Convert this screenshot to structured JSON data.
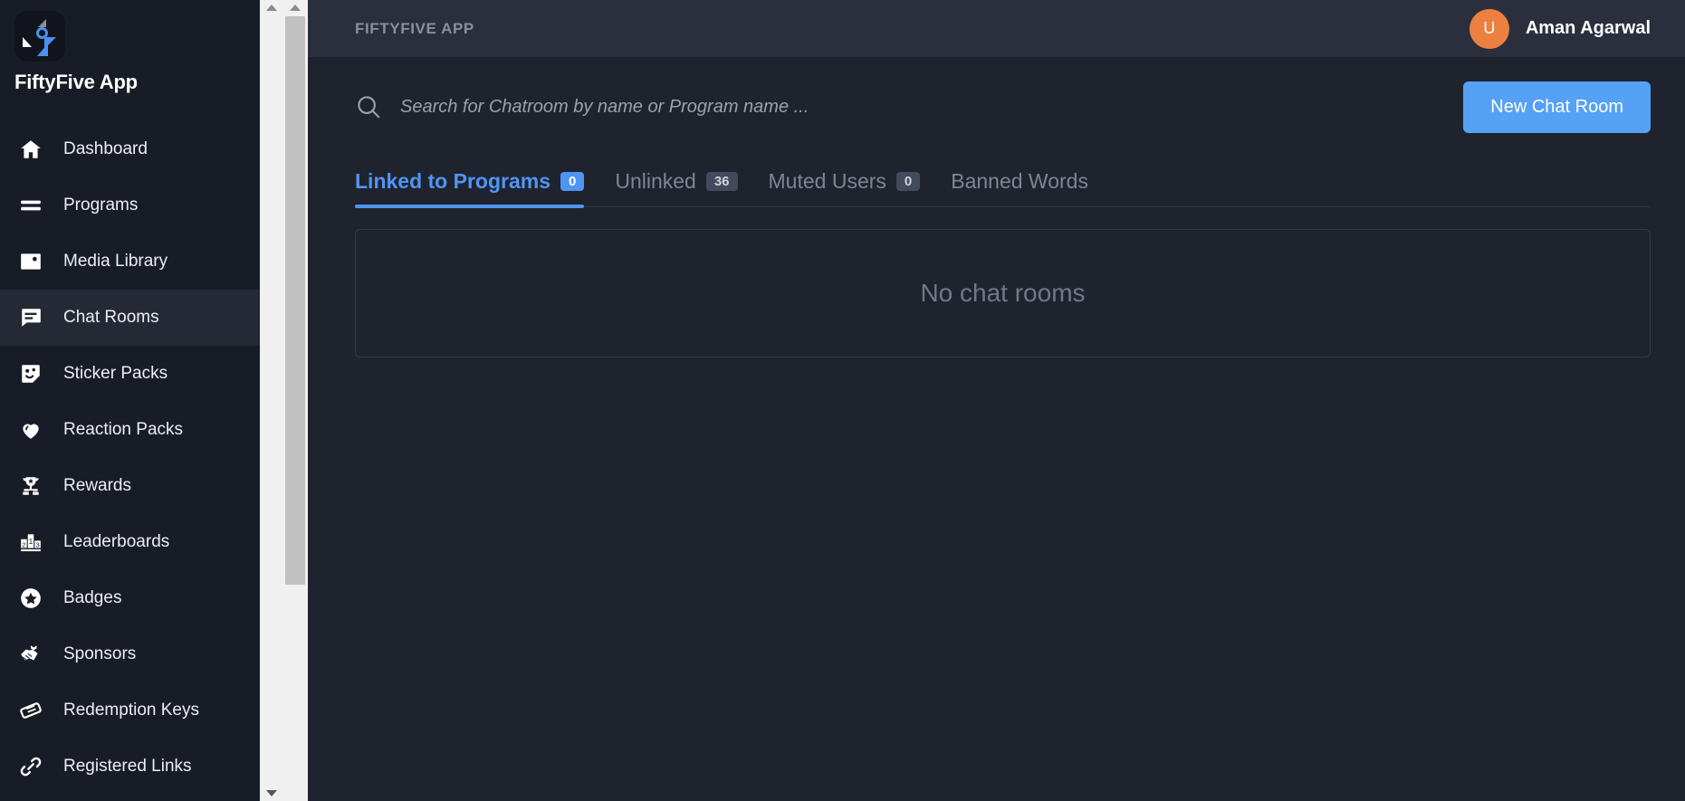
{
  "sidebar": {
    "brand": {
      "name": "FiftyFive App",
      "logo_icon": "fiftyfive-logo-icon"
    },
    "items": [
      {
        "label": "Dashboard",
        "icon": "home-icon",
        "active": false
      },
      {
        "label": "Programs",
        "icon": "list-lines-icon",
        "active": false
      },
      {
        "label": "Media Library",
        "icon": "image-icon",
        "active": false
      },
      {
        "label": "Chat Rooms",
        "icon": "chat-bubble-icon",
        "active": true
      },
      {
        "label": "Sticker Packs",
        "icon": "sticker-face-icon",
        "active": false
      },
      {
        "label": "Reaction Packs",
        "icon": "heart-icon",
        "active": false
      },
      {
        "label": "Rewards",
        "icon": "trophy-icon",
        "active": false
      },
      {
        "label": "Leaderboards",
        "icon": "podium-123-icon",
        "active": false
      },
      {
        "label": "Badges",
        "icon": "star-badge-icon",
        "active": false
      },
      {
        "label": "Sponsors",
        "icon": "handshake-icon",
        "active": false
      },
      {
        "label": "Redemption Keys",
        "icon": "ticket-icon",
        "active": false
      },
      {
        "label": "Registered Links",
        "icon": "link-chain-icon",
        "active": false
      }
    ]
  },
  "topbar": {
    "title": "FIFTYFIVE APP",
    "user": {
      "initial": "U",
      "name": "Aman Agarwal",
      "avatar_color": "#ec8041"
    }
  },
  "search": {
    "icon": "search-icon",
    "placeholder": "Search for Chatroom by name or Program name ...",
    "value": ""
  },
  "actions": {
    "new_chat_room": "New Chat Room"
  },
  "tabs": [
    {
      "label": "Linked to Programs",
      "badge": "0",
      "active": true
    },
    {
      "label": "Unlinked",
      "badge": "36",
      "active": false
    },
    {
      "label": "Muted Users",
      "badge": "0",
      "active": false
    },
    {
      "label": "Banned Words",
      "badge": null,
      "active": false
    }
  ],
  "panel": {
    "empty_message": "No chat rooms"
  },
  "colors": {
    "accent": "#4f95f5",
    "button": "#55a1f5",
    "sidebar_bg": "#181c26",
    "main_bg": "#1f232e",
    "topbar_bg": "#2b2f3d",
    "avatar": "#ec8041"
  },
  "scrollbars": {
    "outer": {
      "up_arrow": "chevron-up-icon",
      "down_arrow": "chevron-down-icon"
    },
    "inner": {
      "up_arrow": "chevron-up-icon"
    }
  }
}
